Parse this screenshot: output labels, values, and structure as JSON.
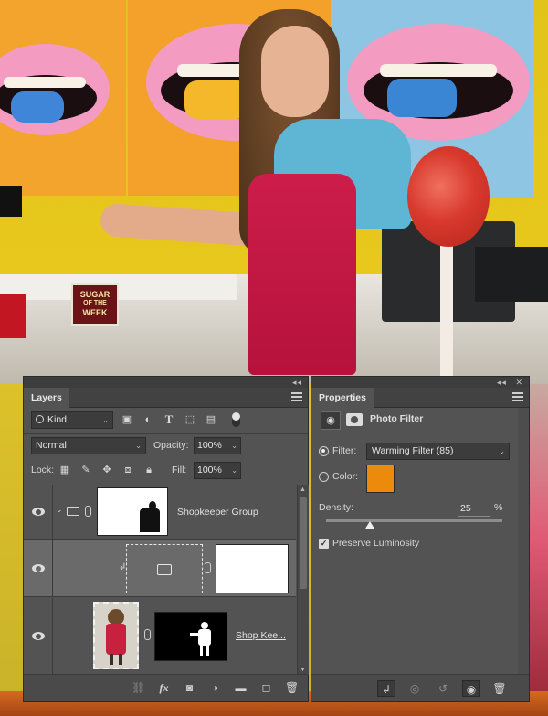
{
  "photo": {
    "sign_text_1": "SUGAR",
    "sign_text_2": "OF THE",
    "sign_text_3": "WEEK"
  },
  "layers_panel": {
    "collapse_label": "◂◂",
    "close_label": "✕",
    "tab_label": "Layers",
    "filter_kind": "Kind",
    "blend_mode": "Normal",
    "opacity_label": "Opacity:",
    "opacity_value": "100%",
    "lock_label": "Lock:",
    "fill_label": "Fill:",
    "fill_value": "100%",
    "layers": [
      {
        "name": "Shopkeeper Group",
        "type": "group",
        "visible": true
      },
      {
        "name": "",
        "type": "adjustment-photo-filter",
        "visible": true,
        "selected": true
      },
      {
        "name": "Shop Kee...",
        "type": "pixel-with-mask",
        "visible": true
      }
    ]
  },
  "properties_panel": {
    "collapse_label": "◂◂",
    "close_label": "✕",
    "tab_label": "Properties",
    "title": "Photo Filter",
    "filter_label": "Filter:",
    "filter_value": "Warming Filter (85)",
    "color_label": "Color:",
    "color_hex": "#ec8a0b",
    "density_label": "Density:",
    "density_value": "25",
    "density_unit": "%",
    "density_level": 0.25,
    "preserve_label": "Preserve Luminosity",
    "preserve_checked": true
  }
}
